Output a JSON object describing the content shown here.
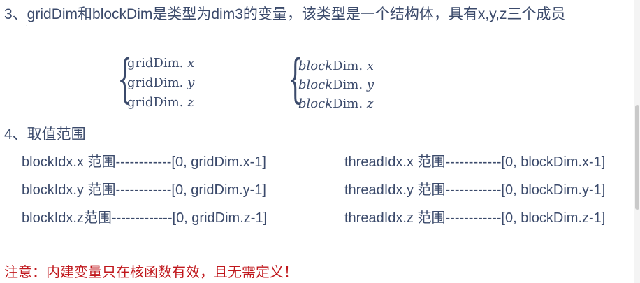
{
  "heading3": "3、gridDim和blockDim是类型为dim3的变量，该类型是一个结构体，具有x,y,z三个成员",
  "dot": ".",
  "grid_dim_fields": [
    {
      "name": "gridDim.",
      "component": "x"
    },
    {
      "name": "gridDim.",
      "component": "y"
    },
    {
      "name": "gridDim.",
      "component": "z"
    }
  ],
  "block_dim_fields": [
    {
      "prefix": "block",
      "name": "Dim.",
      "component": "x"
    },
    {
      "prefix": "block",
      "name": "Dim.",
      "component": "y"
    },
    {
      "prefix": "block",
      "name": "Dim.",
      "component": "z"
    }
  ],
  "heading4": "4、取值范围",
  "block_idx_ranges": [
    "blockIdx.x 范围------------[0, gridDim.x-1]",
    "blockIdx.y 范围------------[0, gridDim.y-1]",
    "blockIdx.z范围-------------[0, gridDim.z-1]"
  ],
  "thread_idx_ranges": [
    "threadIdx.x 范围------------[0, blockDim.x-1]",
    "threadIdx.y 范围------------[0, blockDim.y-1]",
    "threadIdx.z 范围------------[0, blockDim.z-1]"
  ],
  "note": "注意：内建变量只在核函数有效，且无需定义！",
  "colors": {
    "text": "#3b4a6b",
    "note": "#c0171c"
  }
}
